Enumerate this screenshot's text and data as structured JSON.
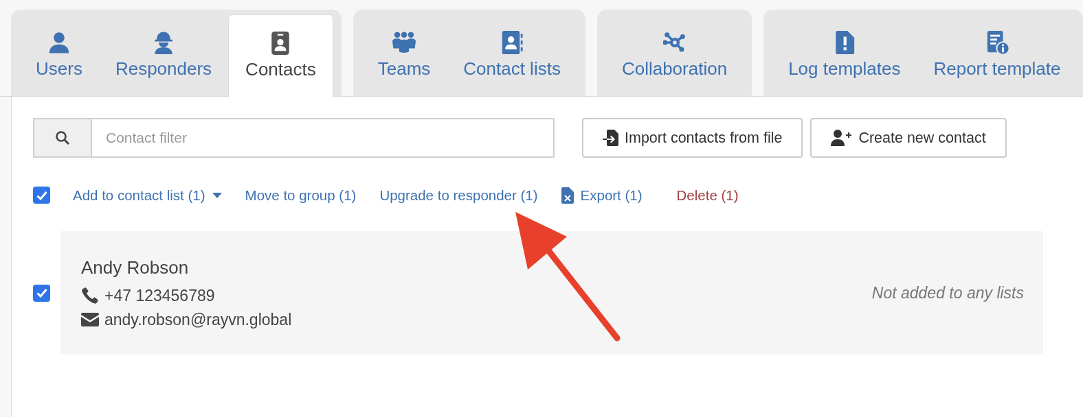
{
  "tab_groups": [
    {
      "tabs": [
        {
          "label": "Users",
          "selected": false
        },
        {
          "label": "Responders",
          "selected": false
        },
        {
          "label": "Contacts",
          "selected": true
        }
      ]
    },
    {
      "tabs": [
        {
          "label": "Teams",
          "selected": false
        },
        {
          "label": "Contact lists",
          "selected": false
        }
      ]
    },
    {
      "tabs": [
        {
          "label": "Collaboration",
          "selected": false
        }
      ]
    },
    {
      "tabs": [
        {
          "label": "Log templates",
          "selected": false
        },
        {
          "label": "Report template",
          "selected": false
        }
      ]
    }
  ],
  "search": {
    "placeholder": "Contact filter"
  },
  "buttons": [
    {
      "label": "Import contacts from file",
      "kind": "import"
    },
    {
      "label": "Create new contact",
      "kind": "create"
    }
  ],
  "select_all": {
    "checked": true
  },
  "actions": [
    {
      "label": "Add to contact list (1)",
      "kind": "menu"
    },
    {
      "label": "Move to group (1)",
      "kind": "link"
    },
    {
      "label": "Upgrade to responder (1)",
      "kind": "link"
    },
    {
      "label": "Export (1)",
      "kind": "export"
    },
    {
      "label": "Delete (1)",
      "kind": "danger"
    }
  ],
  "contacts": [
    {
      "name": "Andy Robson",
      "phone": "+47 123456789",
      "email": "andy.robson@rayvn.global",
      "lists": "Not added to any lists",
      "checked": true
    }
  ]
}
